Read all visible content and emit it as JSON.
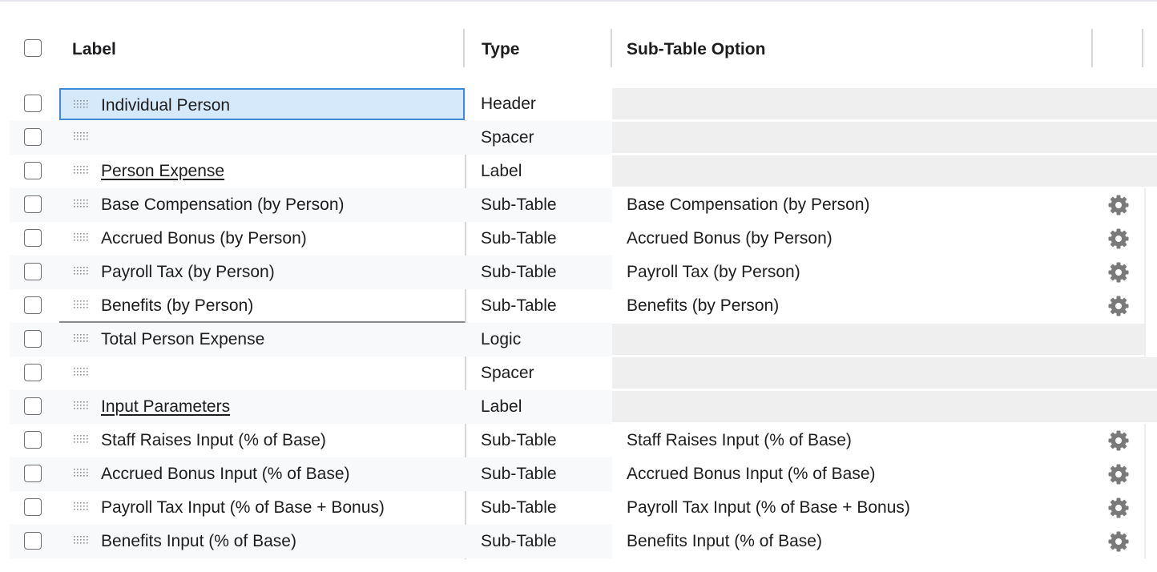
{
  "header": {
    "label": "Label",
    "type": "Type",
    "sub_table_option": "Sub-Table Option"
  },
  "rows": [
    {
      "label": "Individual Person",
      "type": "Header",
      "sub_table_option": ""
    },
    {
      "label": "",
      "type": "Spacer",
      "sub_table_option": ""
    },
    {
      "label": "Person Expense",
      "type": "Label",
      "sub_table_option": ""
    },
    {
      "label": "Base Compensation (by Person)",
      "type": "Sub-Table",
      "sub_table_option": "Base Compensation (by Person)"
    },
    {
      "label": "Accrued Bonus (by Person)",
      "type": "Sub-Table",
      "sub_table_option": "Accrued Bonus (by Person)"
    },
    {
      "label": "Payroll Tax (by Person)",
      "type": "Sub-Table",
      "sub_table_option": "Payroll Tax (by Person)"
    },
    {
      "label": "Benefits (by Person)",
      "type": "Sub-Table",
      "sub_table_option": "Benefits (by Person)"
    },
    {
      "label": "Total Person Expense",
      "type": "Logic",
      "sub_table_option": ""
    },
    {
      "label": "",
      "type": "Spacer",
      "sub_table_option": ""
    },
    {
      "label": "Input Parameters",
      "type": "Label",
      "sub_table_option": ""
    },
    {
      "label": "Staff Raises Input (% of Base)",
      "type": "Sub-Table",
      "sub_table_option": "Staff Raises Input (% of Base)"
    },
    {
      "label": "Accrued Bonus Input (% of Base)",
      "type": "Sub-Table",
      "sub_table_option": "Accrued Bonus Input (% of Base)"
    },
    {
      "label": "Payroll Tax Input (% of Base + Bonus)",
      "type": "Sub-Table",
      "sub_table_option": "Payroll Tax Input (% of Base + Bonus)"
    },
    {
      "label": "Benefits Input (% of Base)",
      "type": "Sub-Table",
      "sub_table_option": "Benefits Input (% of Base)"
    }
  ],
  "icons": {
    "row_drag": "drag-handle-icon",
    "row_settings": "gear-icon"
  },
  "colors": {
    "selection_fill": "#d6e9fb",
    "selection_border": "#3d8ad6",
    "gear": "#7a7a7a"
  }
}
